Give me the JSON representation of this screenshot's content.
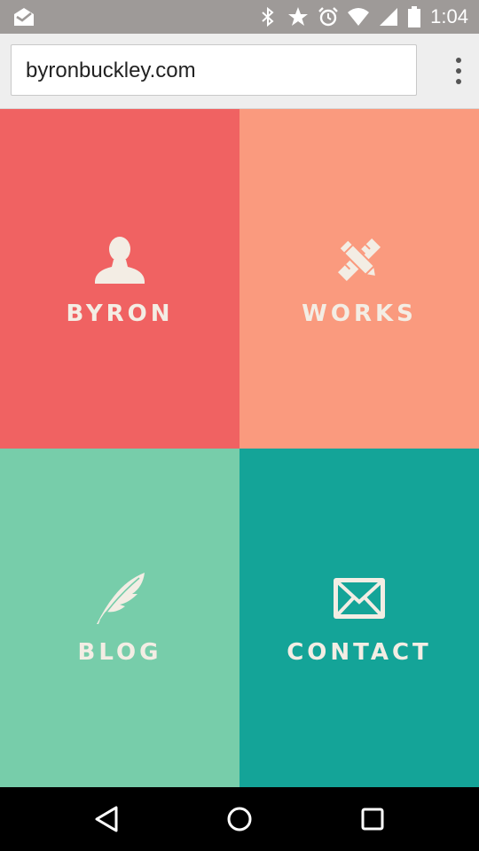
{
  "status_bar": {
    "time": "1:04",
    "icons": [
      "mail-check-icon",
      "bluetooth-icon",
      "star-icon",
      "alarm-icon",
      "wifi-icon",
      "signal-icon",
      "battery-icon"
    ]
  },
  "browser": {
    "url": "byronbuckley.com",
    "menu_icon": "overflow-menu-icon"
  },
  "tiles": [
    {
      "label": "BYRON",
      "icon": "person-icon",
      "color": "#f06262"
    },
    {
      "label": "WORKS",
      "icon": "pencil-ruler-icon",
      "color": "#fa9a7e"
    },
    {
      "label": "BLOG",
      "icon": "feather-quill-icon",
      "color": "#77cdaa"
    },
    {
      "label": "CONTACT",
      "icon": "envelope-icon",
      "color": "#14a498"
    }
  ],
  "nav_bar": {
    "buttons": [
      "back-icon",
      "home-icon",
      "recents-icon"
    ]
  },
  "colors": {
    "status_bar": "#9e9a98",
    "tile_text": "#f3ede4"
  }
}
